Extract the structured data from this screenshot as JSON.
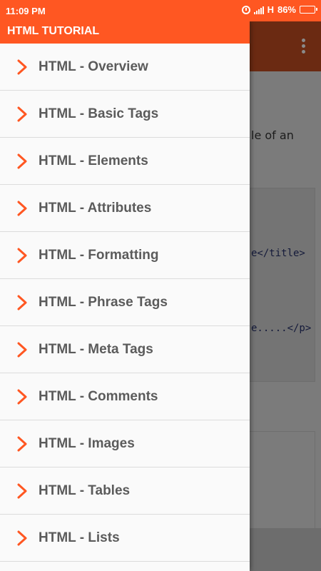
{
  "status_bar": {
    "time": "11:09 PM",
    "network": "H",
    "battery": "86%",
    "battery_level": 0.86,
    "icons": [
      "alarm-icon",
      "signal-icon",
      "battery-icon"
    ]
  },
  "drawer": {
    "title": "HTML TUTORIAL",
    "items": [
      {
        "label": "HTML - Overview"
      },
      {
        "label": "HTML - Basic Tags"
      },
      {
        "label": "HTML - Elements"
      },
      {
        "label": "HTML - Attributes"
      },
      {
        "label": "HTML - Formatting"
      },
      {
        "label": "HTML - Phrase Tags"
      },
      {
        "label": "HTML - Meta Tags"
      },
      {
        "label": "HTML - Comments"
      },
      {
        "label": "HTML - Images"
      },
      {
        "label": "HTML - Tables"
      },
      {
        "label": "HTML - Lists"
      }
    ]
  },
  "background_page": {
    "text_fragment": "le of an",
    "code_lines": [
      "e</title>",
      "e.....</p>"
    ]
  },
  "colors": {
    "accent": "#ff5722",
    "chevron": "#ff5722",
    "item_text": "#5b5b5b",
    "drawer_bg": "#fafafa"
  }
}
